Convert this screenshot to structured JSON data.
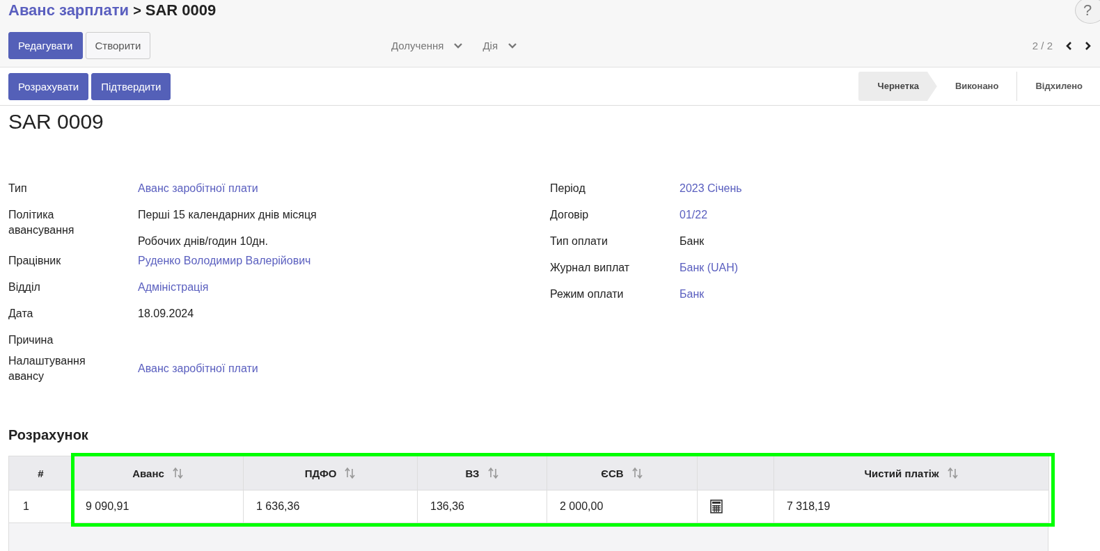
{
  "breadcrumb": {
    "parent": "Аванс зарплати",
    "separator": ">",
    "current": "SAR 0009"
  },
  "help": "?",
  "toolbar": {
    "buttons": [
      {
        "label": "Редагувати",
        "kind": "primary"
      },
      {
        "label": "Створити",
        "kind": "secondary"
      }
    ],
    "dropdowns": [
      "Долучення",
      "Дія"
    ],
    "pager": "2 / 2"
  },
  "actions": [
    "Розрахувати",
    "Підтвердити"
  ],
  "stages": [
    {
      "label": "Чернетка",
      "selected": true
    },
    {
      "label": "Виконано",
      "selected": false
    },
    {
      "label": "Відхилено",
      "selected": false
    }
  ],
  "record_title": "SAR 0009",
  "left_fields": [
    {
      "label": "Тип",
      "values": [
        {
          "text": "Аванс заробітної плати",
          "kind": "link"
        }
      ]
    },
    {
      "label": "Політика авансування",
      "values": [
        {
          "text": "Перші 15 календарних днів місяця",
          "kind": "text"
        },
        {
          "text": "Робочих днів/годин  10дн.",
          "kind": "text"
        }
      ]
    },
    {
      "label": "Працівник",
      "values": [
        {
          "text": "Руденко Володимир Валерійович",
          "kind": "link"
        }
      ]
    },
    {
      "label": "Відділ",
      "values": [
        {
          "text": "Адміністрація",
          "kind": "link"
        }
      ]
    },
    {
      "label": "Дата",
      "values": [
        {
          "text": "18.09.2024",
          "kind": "text"
        }
      ]
    },
    {
      "label": "Причина"
    },
    {
      "label": "Налаштування авансу",
      "values": [
        {
          "text": "Аванс заробітної плати",
          "kind": "link"
        }
      ]
    }
  ],
  "right_fields": [
    {
      "label": "Період",
      "values": [
        {
          "text": "2023 Січень",
          "kind": "link"
        }
      ]
    },
    {
      "label": "Договір",
      "values": [
        {
          "text": "01/22",
          "kind": "link"
        }
      ]
    },
    {
      "label": "Тип оплати",
      "values": [
        {
          "text": "Банк",
          "kind": "text"
        }
      ]
    },
    {
      "label": "Журнал виплат",
      "values": [
        {
          "text": "Банк (UAH)",
          "kind": "link"
        }
      ]
    },
    {
      "label": "Режим оплати",
      "values": [
        {
          "text": "Банк",
          "kind": "link"
        }
      ]
    }
  ],
  "section_title": "Розрахунок",
  "table": {
    "columns": [
      {
        "label": "#",
        "sortable": false
      },
      {
        "label": "Аванс",
        "sortable": true
      },
      {
        "label": "ПДФО",
        "sortable": true
      },
      {
        "label": "ВЗ",
        "sortable": true
      },
      {
        "label": "ЄСВ",
        "sortable": true
      },
      {
        "sortable": false
      },
      {
        "label": "Чистий платіж",
        "sortable": true
      }
    ],
    "rows": [
      [
        {
          "kind": "text",
          "text": "1"
        },
        {
          "kind": "text",
          "text": "9 090,91"
        },
        {
          "kind": "text",
          "text": "1 636,36"
        },
        {
          "kind": "text",
          "text": "136,36"
        },
        {
          "kind": "text",
          "text": "2 000,00"
        },
        {
          "kind": "icon"
        },
        {
          "kind": "text",
          "text": "7 318,19"
        }
      ]
    ]
  }
}
